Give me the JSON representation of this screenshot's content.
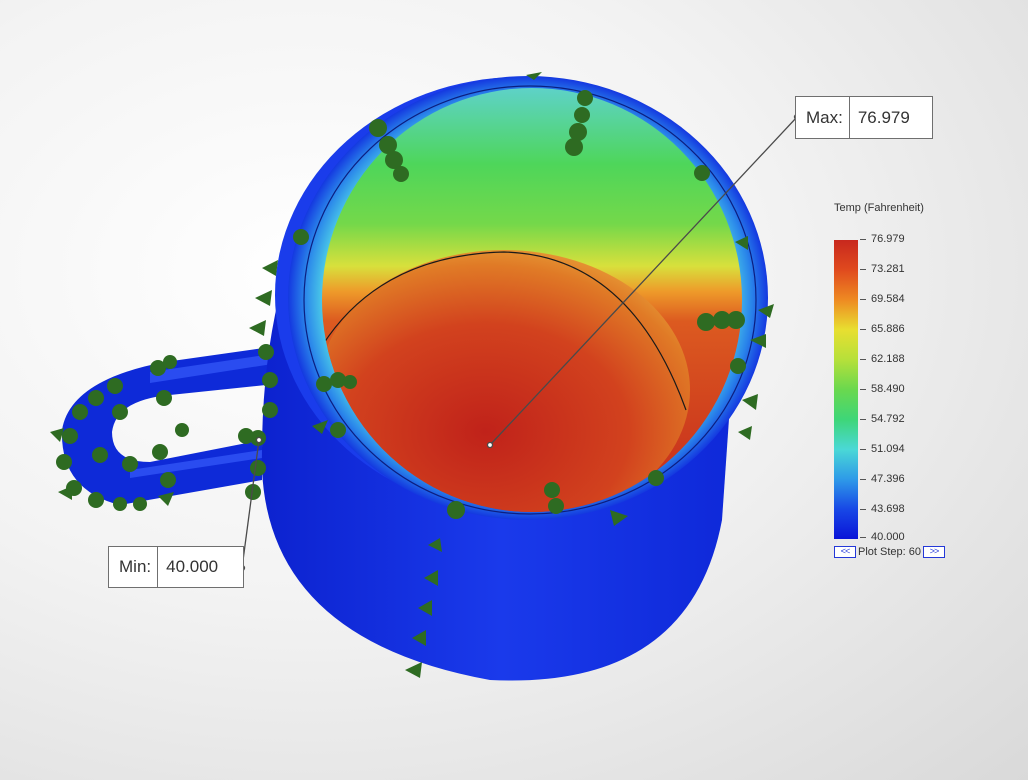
{
  "callouts": {
    "max": {
      "label": "Max:",
      "value": "76.979"
    },
    "min": {
      "label": "Min:",
      "value": "40.000"
    }
  },
  "legend": {
    "title": "Temp (Fahrenheit)",
    "ticks": [
      "76.979",
      "73.281",
      "69.584",
      "65.886",
      "62.188",
      "58.490",
      "54.792",
      "51.094",
      "47.396",
      "43.698",
      "40.000"
    ],
    "plot_step_label": "Plot Step: 60",
    "prev_icon": "double-chevron-left-icon",
    "next_icon": "double-chevron-right-icon"
  },
  "colors": {
    "hot": "#c8281e",
    "warm": "#ee8a22",
    "mid": "#6ad84e",
    "cool": "#4ad8d6",
    "cold": "#0a14d8",
    "marker": "#2e6b22"
  }
}
